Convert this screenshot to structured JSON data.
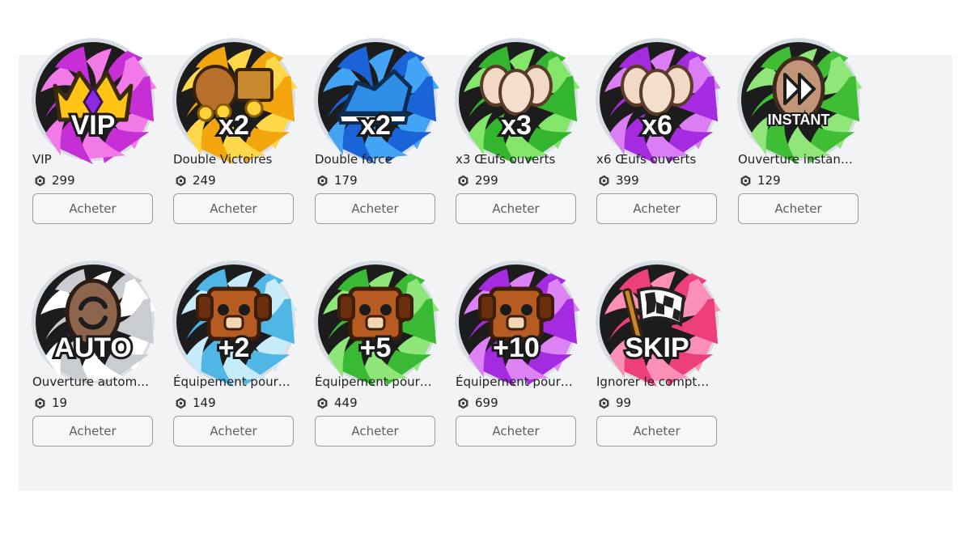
{
  "buy_label": "Acheter",
  "row1": [
    {
      "name": "VIP",
      "price": "299",
      "badge_text": "VIP",
      "icon": "crown-icon",
      "colors": [
        "#c62fd6",
        "#f27ae8"
      ]
    },
    {
      "name": "Double Victoires",
      "price": "249",
      "badge_text": "x2",
      "icon": "gold-treasure-icon",
      "colors": [
        "#f2a50c",
        "#ffd84a"
      ]
    },
    {
      "name": "Double force",
      "price": "179",
      "badge_text": "x2",
      "icon": "sneaker-icon",
      "colors": [
        "#1b64d8",
        "#43a4f5"
      ]
    },
    {
      "name": "x3 Œufs ouverts",
      "price": "299",
      "badge_text": "x3",
      "icon": "eggs-icon",
      "colors": [
        "#34b52f",
        "#83e56a"
      ]
    },
    {
      "name": "x6 Œufs ouverts",
      "price": "399",
      "badge_text": "x6",
      "icon": "eggs-icon",
      "colors": [
        "#a52be0",
        "#db7df3"
      ]
    },
    {
      "name": "Ouverture instan…",
      "price": "129",
      "badge_text": "INSTANT",
      "icon": "fast-forward-egg-icon",
      "colors": [
        "#3fbd35",
        "#90e679"
      ]
    }
  ],
  "row2": [
    {
      "name": "Ouverture autom…",
      "price": "19",
      "badge_text": "AUTO",
      "icon": "auto-egg-icon",
      "colors": [
        "#c9ccd1",
        "#ffffff"
      ]
    },
    {
      "name": "Équipement pour…",
      "price": "149",
      "badge_text": "+2",
      "icon": "dog-pet-icon",
      "colors": [
        "#4fb6e6",
        "#c6ecfb"
      ]
    },
    {
      "name": "Équipement pour…",
      "price": "449",
      "badge_text": "+5",
      "icon": "dog-pet-icon",
      "colors": [
        "#3aba34",
        "#8fe678"
      ]
    },
    {
      "name": "Équipement pour…",
      "price": "699",
      "badge_text": "+10",
      "icon": "dog-pet-icon",
      "colors": [
        "#a52be0",
        "#dc82f4"
      ]
    },
    {
      "name": "Ignorer le compt…",
      "price": "99",
      "badge_text": "SKIP",
      "icon": "checkered-flag-icon",
      "colors": [
        "#ec3f7b",
        "#fb8fb7"
      ]
    }
  ]
}
